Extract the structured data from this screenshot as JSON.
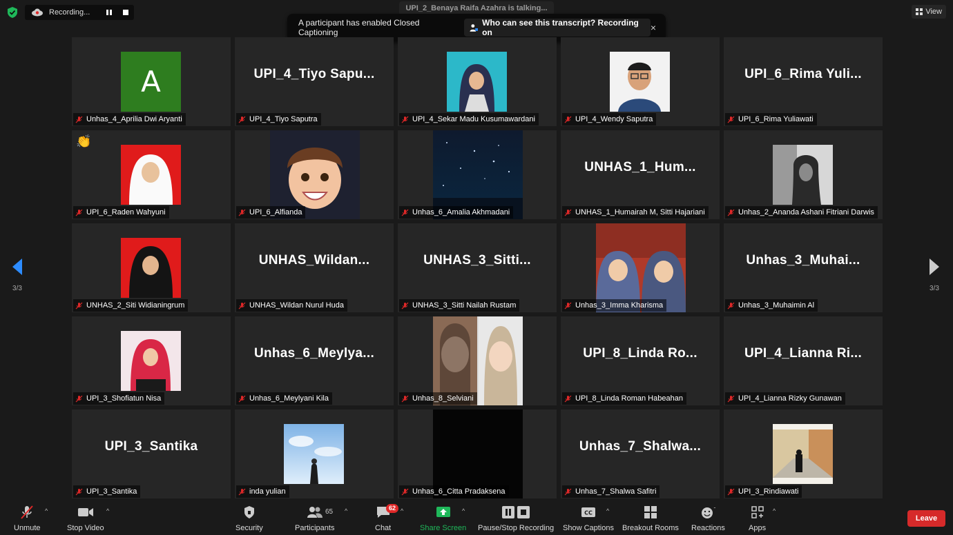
{
  "top": {
    "recording_label": "Recording...",
    "talking_label": "UPI_2_Benaya Raifa Azahra is talking...",
    "cc_message": "A participant has enabled Closed Captioning",
    "cc_link": "Who can see this transcript? Recording on",
    "close": "×",
    "view": "View"
  },
  "tiles": [
    {
      "label": "Unhas_4_Aprilia Dwi Aryanti",
      "big": "",
      "photo": "avatar-letter",
      "letter": "A"
    },
    {
      "label": "UPI_4_Tiyo Saputra",
      "big": "UPI_4_Tiyo  Sapu...",
      "photo": ""
    },
    {
      "label": "UPI_4_Sekar Madu Kusumawardani",
      "big": "",
      "photo": "hijab-cyan"
    },
    {
      "label": "UPI_4_Wendy Saputra",
      "big": "",
      "photo": "man-glasses"
    },
    {
      "label": "UPI_6_Rima Yuliawati",
      "big": "UPI_6_Rima  Yuli...",
      "photo": ""
    },
    {
      "label": "UPI_6_Raden Wahyuni",
      "big": "",
      "photo": "hijab-red-white",
      "reaction": "👏"
    },
    {
      "label": "UPI_6_Alfianda",
      "big": "",
      "photo": "memoji"
    },
    {
      "label": "Unhas_6_Amalia Akhmadani",
      "big": "",
      "photo": "starry"
    },
    {
      "label": "UNHAS_1_Humairah M, Sitti Hajariani",
      "big": "UNHAS_1_Hum...",
      "photo": ""
    },
    {
      "label": "Unhas_2_Ananda Ashani Fitriani Darwis",
      "big": "",
      "photo": "bw-portrait"
    },
    {
      "label": "UNHAS_2_Siti Widianingrum",
      "big": "",
      "photo": "hijab-red-black"
    },
    {
      "label": "UNHAS_Wildan Nurul Huda",
      "big": "UNHAS_Wildan...",
      "photo": ""
    },
    {
      "label": "UNHAS_3_Sitti Nailah Rustam",
      "big": "UNHAS_3_Sitti...",
      "photo": ""
    },
    {
      "label": "Unhas_3_Imma Kharisma",
      "big": "",
      "photo": "two-hijab-red"
    },
    {
      "label": "Unhas_3_Muhaimin Al",
      "big": "Unhas_3_Muhai...",
      "photo": ""
    },
    {
      "label": "UPI_3_Shofiatun Nisa",
      "big": "",
      "photo": "hijab-pink"
    },
    {
      "label": "Unhas_6_Meylyani Kila",
      "big": "Unhas_6_Meylya...",
      "photo": ""
    },
    {
      "label": "Unhas_8_Selviani",
      "big": "",
      "photo": "two-selfie"
    },
    {
      "label": "UPI_8_Linda Roman Habeahan",
      "big": "UPI_8_Linda  Ro...",
      "photo": ""
    },
    {
      "label": "UPI_4_Lianna Rizky Gunawan",
      "big": "UPI_4_Lianna  Ri...",
      "photo": ""
    },
    {
      "label": "UPI_3_Santika",
      "big": "UPI_3_Santika",
      "photo": ""
    },
    {
      "label": "inda yulian",
      "big": "",
      "photo": "sky"
    },
    {
      "label": "Unhas_6_Citta Pradaksena",
      "big": "",
      "photo": "black"
    },
    {
      "label": "Unhas_7_Shalwa Safitri",
      "big": "Unhas_7_Shalwa...",
      "photo": ""
    },
    {
      "label": "UPI_3_Rindiawati",
      "big": "",
      "photo": "corridor"
    }
  ],
  "nav": {
    "left_page": "3/3",
    "right_page": "3/3"
  },
  "toolbar": {
    "unmute": "Unmute",
    "stop_video": "Stop Video",
    "security": "Security",
    "participants": "Participants",
    "participants_count": "65",
    "chat": "Chat",
    "chat_badge": "62",
    "share_screen": "Share Screen",
    "pause_stop_recording": "Pause/Stop Recording",
    "show_captions": "Show Captions",
    "breakout_rooms": "Breakout Rooms",
    "reactions": "Reactions",
    "apps": "Apps",
    "leave": "Leave"
  },
  "colors": {
    "accent_green": "#1fb85a",
    "leave_red": "#d62a2a",
    "arrow_blue": "#2d8cff",
    "badge_red": "#e02828"
  }
}
